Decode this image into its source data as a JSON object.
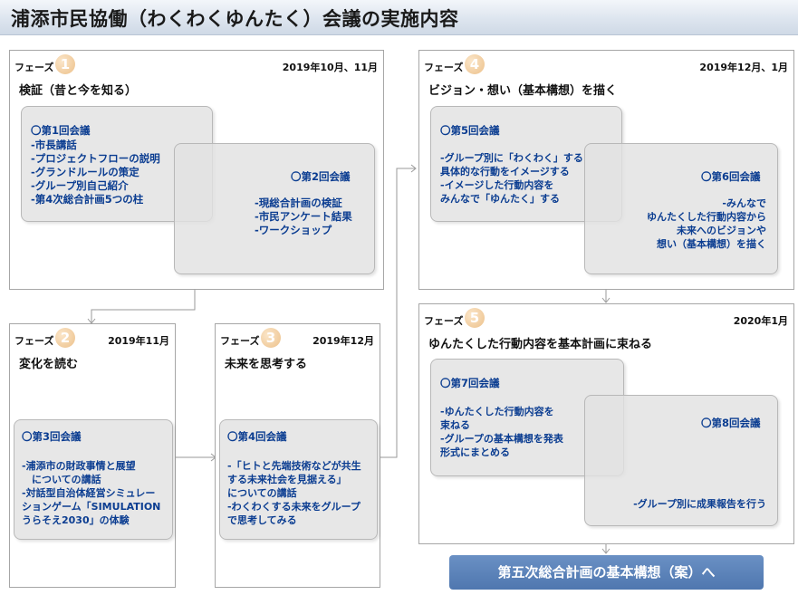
{
  "title": "浦添市民協働（わくわくゆんたく）会議の実施内容",
  "phase_label": "フェーズ",
  "phases": [
    {
      "num": "1",
      "date": "2019年10月、11月",
      "title": "検証（昔と今を知る）",
      "meetings": [
        {
          "head": "〇第1回会議",
          "lines": [
            "-市長講話",
            "-プロジェクトフローの説明",
            "-グランドルールの策定",
            "-グループ別自己紹介",
            "-第4次総合計画5つの柱"
          ]
        },
        {
          "head": "〇第2回会議",
          "lines": [
            "-現総合計画の検証",
            "-市民アンケート結果",
            "-ワークショップ"
          ]
        }
      ]
    },
    {
      "num": "2",
      "date": "2019年11月",
      "title": "変化を読む",
      "meetings": [
        {
          "head": "〇第3回会議",
          "lines": [
            "-浦添市の財政事情と展望",
            "　についての講話",
            "-対話型自治体経営シミュレー",
            "ションゲーム「SIMULATION",
            "うらそえ2030」の体験"
          ]
        }
      ]
    },
    {
      "num": "3",
      "date": "2019年12月",
      "title": "未来を思考する",
      "meetings": [
        {
          "head": "〇第4回会議",
          "lines": [
            "-「ヒトと先端技術などが共生",
            "する未来社会を見据える」",
            "についての講話",
            "-わくわくする未来をグループ",
            "で思考してみる"
          ]
        }
      ]
    },
    {
      "num": "4",
      "date": "2019年12月、1月",
      "title": "ビジョン・想い（基本構想）を描く",
      "meetings": [
        {
          "head": "〇第5回会議",
          "lines": [
            "-グループ別に「わくわく」する",
            "具体的な行動をイメージする",
            "-イメージした行動内容を",
            "みんなで「ゆんたく」する"
          ]
        },
        {
          "head": "〇第6回会議",
          "lines": [
            "-みんなで",
            "ゆんたくした行動内容から",
            "未来へのビジョンや",
            "想い（基本構想）を描く"
          ]
        }
      ]
    },
    {
      "num": "5",
      "date": "2020年1月",
      "title": "ゆんたくした行動内容を基本計画に束ねる",
      "meetings": [
        {
          "head": "〇第7回会議",
          "lines": [
            "-ゆんたくした行動内容を",
            "束ねる",
            "-グループの基本構想を発表",
            "形式にまとめる"
          ]
        },
        {
          "head": "〇第8回会議",
          "lines": [
            "-グループ別に成果報告を行う"
          ]
        }
      ]
    }
  ],
  "final_box": "第五次総合計画の基本構想（案）へ"
}
